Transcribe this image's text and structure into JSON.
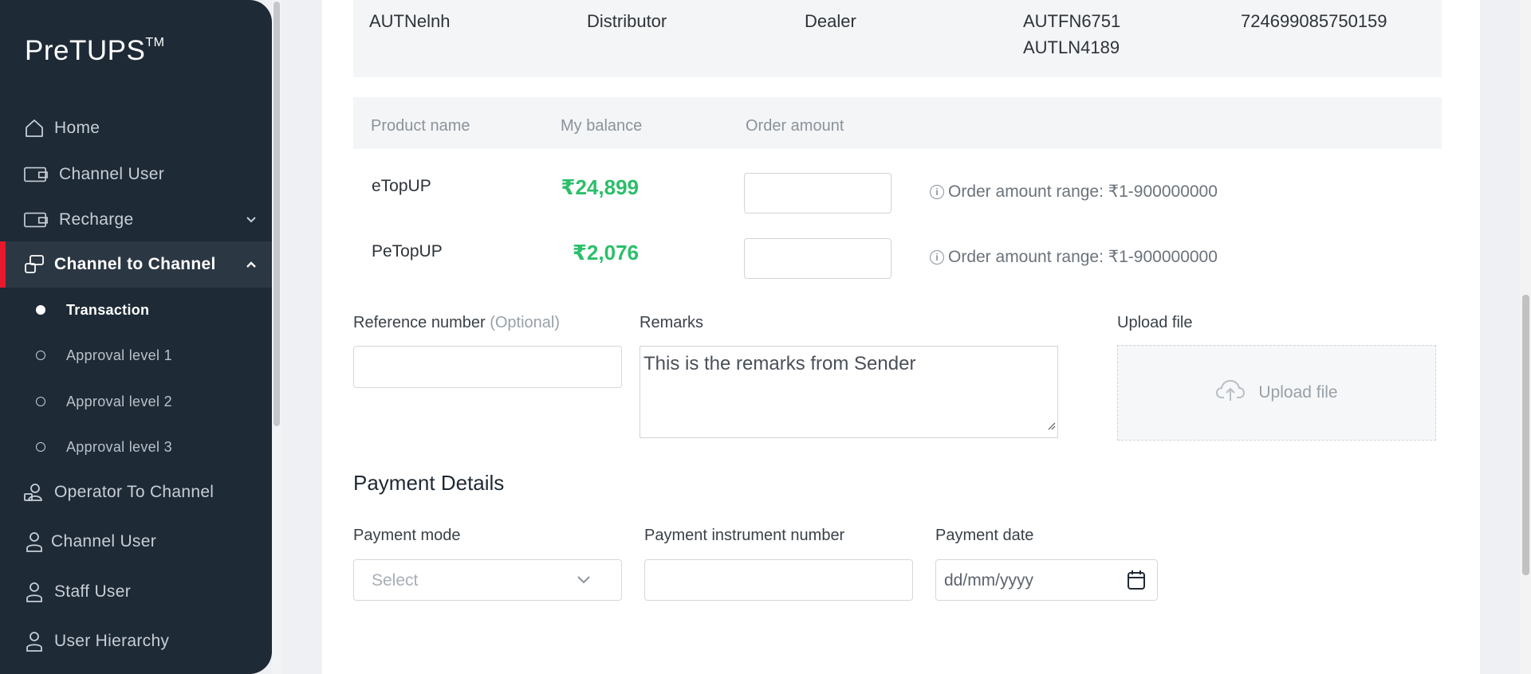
{
  "app": {
    "logo": "PreTUPS",
    "logo_tm": "TM"
  },
  "sidebar": {
    "items": [
      {
        "label": "Home",
        "icon": "home-icon"
      },
      {
        "label": "Channel User",
        "icon": "wallet-icon"
      },
      {
        "label": "Recharge",
        "icon": "wallet-icon",
        "expanded": false
      },
      {
        "label": "Channel to Channel",
        "icon": "transfer-icon",
        "expanded": true,
        "active": true
      },
      {
        "label": "Operator To Channel",
        "icon": "operator-icon"
      },
      {
        "label": "Channel User",
        "icon": "user-icon"
      },
      {
        "label": "Staff User",
        "icon": "user-icon"
      },
      {
        "label": "User Hierarchy",
        "icon": "user-icon"
      }
    ],
    "sub_items": [
      {
        "label": "Transaction",
        "active": true
      },
      {
        "label": "Approval level 1"
      },
      {
        "label": "Approval level 2"
      },
      {
        "label": "Approval level 3"
      }
    ]
  },
  "user_info": {
    "name": "AUTNelnh",
    "category": "Distributor",
    "type": "Dealer",
    "first_name": "AUTFN6751",
    "last_name": "AUTLN4189",
    "mobile": "724699085750159"
  },
  "products": {
    "headers": {
      "name": "Product name",
      "balance": "My balance",
      "amount": "Order amount"
    },
    "rows": [
      {
        "name": "eTopUP",
        "balance": "₹24,899",
        "range": "Order amount range: ₹1-900000000"
      },
      {
        "name": "PeTopUP",
        "balance": "₹2,076",
        "range": "Order amount range: ₹1-900000000"
      }
    ]
  },
  "form": {
    "reference_label": "Reference number",
    "reference_optional": "(Optional)",
    "remarks_label": "Remarks",
    "remarks_value": "This is the remarks from Sender",
    "upload_label": "Upload file",
    "upload_button": "Upload file"
  },
  "payment": {
    "title": "Payment Details",
    "mode_label": "Payment mode",
    "mode_placeholder": "Select",
    "instrument_label": "Payment instrument number",
    "date_label": "Payment date",
    "date_placeholder": "dd/mm/yyyy"
  },
  "colors": {
    "sidebar_bg": "#1e2a36",
    "accent": "#e8192c",
    "balance_green": "#2bbf6a"
  }
}
